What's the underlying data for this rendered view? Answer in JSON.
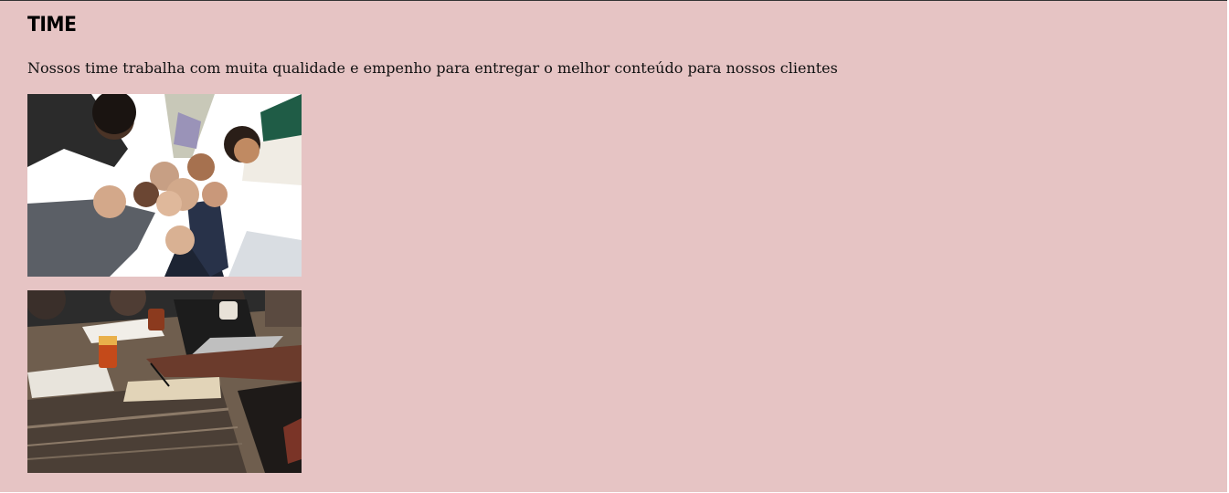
{
  "section": {
    "title": "TIME",
    "description": "Nossos time trabalha com muita qualidade e empenho para entregar o melhor conteúdo para nossos clientes"
  },
  "images": [
    {
      "icon": "team-fist-bump-photo",
      "subject": "team members fist bump"
    },
    {
      "icon": "team-meeting-table-photo",
      "subject": "team meeting at a table"
    }
  ],
  "colors": {
    "background": "#e6c4c4",
    "text": "#000000"
  }
}
